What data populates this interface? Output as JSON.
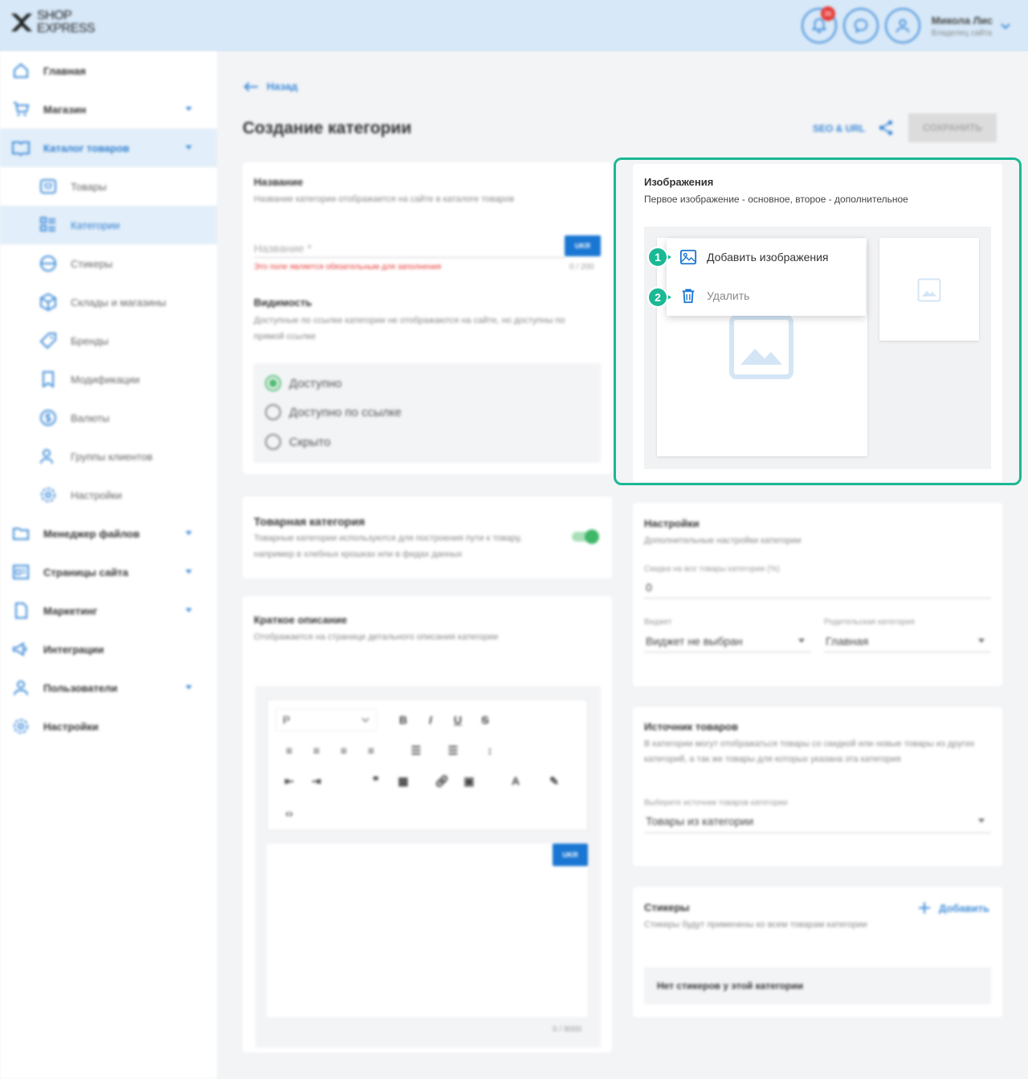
{
  "brand": {
    "line1": "SHOP",
    "line2": "EXPRESS"
  },
  "header": {
    "notifications_count": "36",
    "user_name": "Микола Лис",
    "user_role": "Владелец сайта"
  },
  "sidebar": {
    "items": [
      {
        "label": "Главная",
        "icon": "home-icon"
      },
      {
        "label": "Магазин",
        "icon": "cart-icon"
      },
      {
        "label": "Каталог товаров",
        "icon": "book-icon"
      },
      {
        "label": "Товары",
        "icon": "box-icon"
      },
      {
        "label": "Категории",
        "icon": "list-icon"
      },
      {
        "label": "Стикеры",
        "icon": "sticker-icon"
      },
      {
        "label": "Склады и магазины",
        "icon": "warehouse-icon"
      },
      {
        "label": "Бренды",
        "icon": "tag-icon"
      },
      {
        "label": "Модификации",
        "icon": "bookmark-icon"
      },
      {
        "label": "Валюты",
        "icon": "currency-icon"
      },
      {
        "label": "Группы клиентов",
        "icon": "users-icon"
      },
      {
        "label": "Настройки",
        "icon": "gear-icon"
      },
      {
        "label": "Менеджер файлов",
        "icon": "folder-icon"
      },
      {
        "label": "Страницы сайта",
        "icon": "pages-icon"
      },
      {
        "label": "Маркетинг",
        "icon": "marketing-icon"
      },
      {
        "label": "Интеграции",
        "icon": "megaphone-icon"
      },
      {
        "label": "Пользователи",
        "icon": "user-icon"
      },
      {
        "label": "Настройки",
        "icon": "gear-icon"
      }
    ]
  },
  "page": {
    "back_label": "Назад",
    "title": "Создание категории",
    "seo_label": "SEO & URL",
    "save_label": "СОХРАНИТЬ"
  },
  "name_card": {
    "title": "Название",
    "subtitle": "Название категории отображается на сайте в каталоге товаров",
    "placeholder": "Название *",
    "lang": "UKR",
    "error": "Это поле является обязательным для заполнения",
    "counter": "0 / 200"
  },
  "visibility": {
    "title": "Видимость",
    "subtitle": "Доступные по ссылке категории не отображаются на сайте, но доступны по прямой ссылке",
    "options": [
      {
        "label": "Доступно",
        "checked": true
      },
      {
        "label": "Доступно по ссылке",
        "checked": false
      },
      {
        "label": "Скрыто",
        "checked": false
      }
    ]
  },
  "product_category": {
    "title": "Товарная категория",
    "subtitle": "Товарные категории используются для построения пути к товару, например в хлебных крошках или в фидах данных",
    "enabled": true
  },
  "short_description": {
    "title": "Краткое описание",
    "subtitle": "Отображается на странице детального описания категории",
    "paragraph_select": "P",
    "lang": "UKR",
    "counter": "0 / 9000"
  },
  "images": {
    "title": "Изображения",
    "subtitle": "Первое изображение - основное, второе - дополнительное",
    "menu": {
      "add_label": "Добавить изображения",
      "delete_label": "Удалить"
    },
    "steps": [
      "1",
      "2"
    ],
    "accent": "#1bb894"
  },
  "settings": {
    "title": "Настройки",
    "subtitle": "Дополнительные настройки категории",
    "discount_label": "Скидка на все товары категории (%)",
    "discount_value": "0",
    "widget_label": "Виджет",
    "widget_value": "Виджет не выбран",
    "parent_label": "Родительская категория",
    "parent_value": "Главная"
  },
  "source": {
    "title": "Источник товаров",
    "subtitle": "В категории могут отображаться товары со скидкой или новые товары из других категорий, а так же товары для которых указана эта категория",
    "select_label": "Выберите источник товаров категории",
    "select_value": "Товары из категории"
  },
  "stickers": {
    "title": "Стикеры",
    "subtitle": "Стикеры будут применены ко всем товарам категории",
    "add_label": "Добавить",
    "empty_label": "Нет стикеров у этой категории"
  }
}
